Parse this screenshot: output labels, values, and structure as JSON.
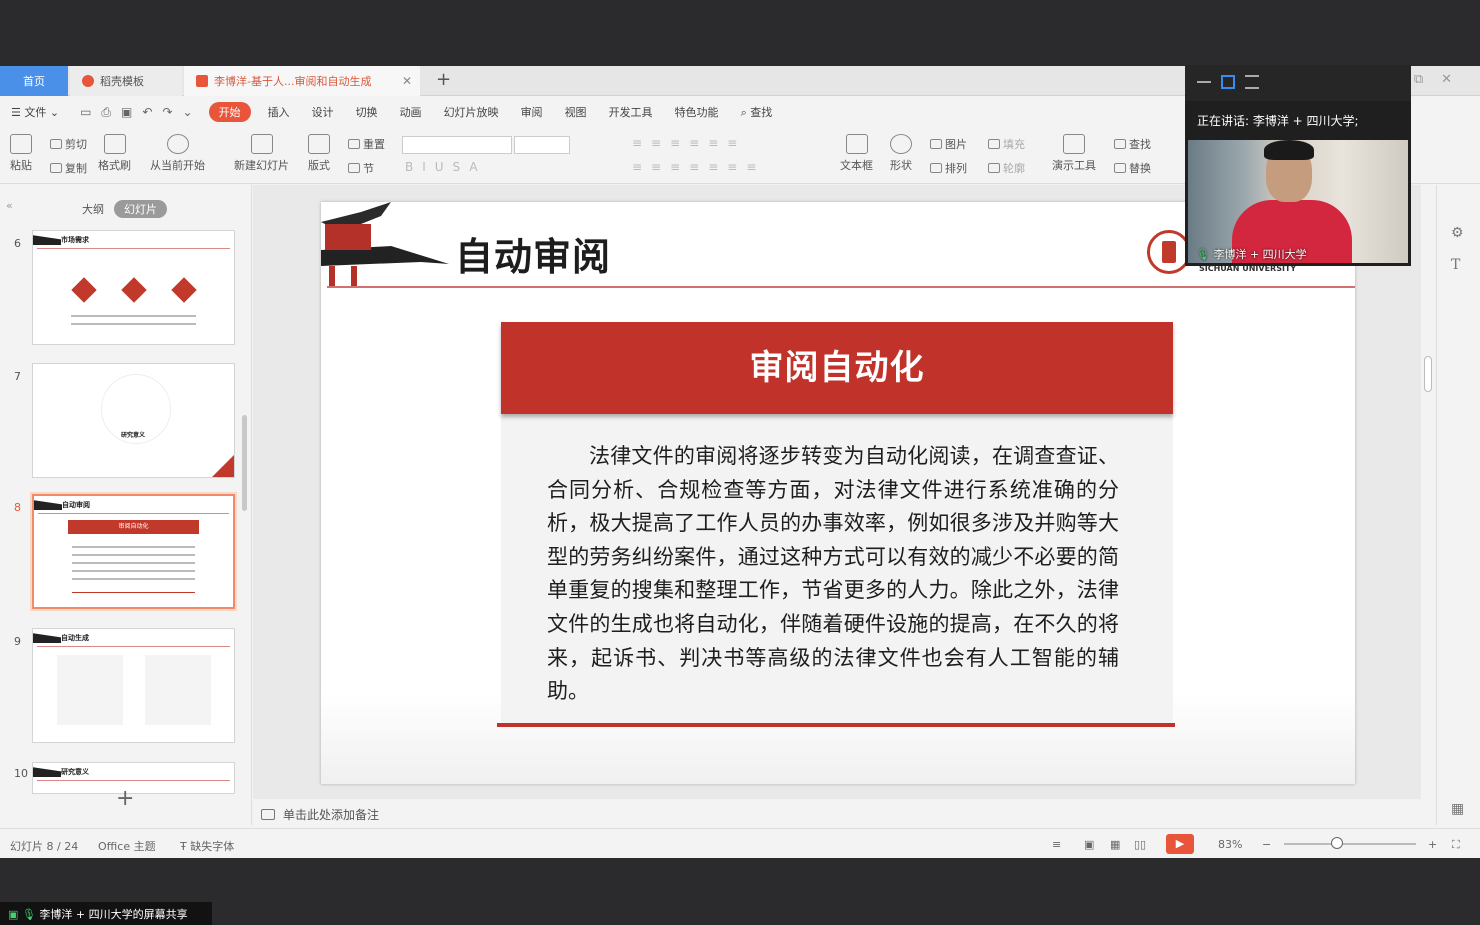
{
  "tabs": {
    "home": "首页",
    "template": "稻壳模板",
    "document": "李博洋-基于人...审阅和自动生成"
  },
  "menu": {
    "file": "文件",
    "items": [
      "开始",
      "插入",
      "设计",
      "切换",
      "动画",
      "幻灯片放映",
      "审阅",
      "视图",
      "开发工具",
      "特色功能",
      "查找"
    ]
  },
  "ribbon": {
    "paste": "粘贴",
    "cut": "剪切",
    "copy": "复制",
    "format_painter": "格式刷",
    "from_current": "从当前开始",
    "new_slide": "新建幻灯片",
    "layout": "版式",
    "reset": "重置",
    "section": "节",
    "textbox": "文本框",
    "shape": "形状",
    "picture": "图片",
    "arrange": "排列",
    "fill": "填充",
    "outline": "轮廓",
    "present_tool": "演示工具",
    "find": "查找",
    "replace": "替换"
  },
  "left_panel": {
    "outline_tab": "大纲",
    "slides_tab": "幻灯片",
    "thumbs": [
      {
        "num": "6",
        "title": "市场需求"
      },
      {
        "num": "7",
        "title": "研究意义"
      },
      {
        "num": "8",
        "title": "自动审阅",
        "banner": "审阅自动化"
      },
      {
        "num": "9",
        "title": "自动生成"
      },
      {
        "num": "10",
        "title": "研究意义"
      }
    ]
  },
  "slide": {
    "title": "自动审阅",
    "logo_en": "SICHUAN UNIVERSITY",
    "card_title": "审阅自动化",
    "card_body": "法律文件的审阅将逐步转变为自动化阅读，在调查查证、合同分析、合规检查等方面，对法律文件进行系统准确的分析，极大提高了工作人员的办事效率，例如很多涉及并购等大型的劳务纠纷案件，通过这种方式可以有效的减少不必要的简单重复的搜集和整理工作，节省更多的人力。除此之外，法律文件的生成也将自动化，伴随着硬件设施的提高，在不久的将来，起诉书、判决书等高级的法律文件也会有人工智能的辅助。"
  },
  "notes_placeholder": "单击此处添加备注",
  "status": {
    "slide_counter": "幻灯片 8 / 24",
    "theme": "Office 主题",
    "missing_font": "缺失字体",
    "zoom": "83%"
  },
  "video": {
    "speaking": "正在讲话: 李博洋 + 四川大学;",
    "participant": "李博洋 + 四川大学"
  },
  "share_label": "李博洋 + 四川大学的屏幕共享",
  "colors": {
    "accent": "#e8553a",
    "slide_red": "#c0322a",
    "home_tab": "#4a8fe8"
  }
}
